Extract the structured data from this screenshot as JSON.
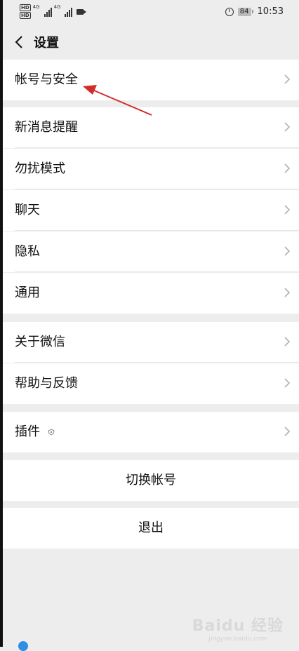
{
  "status_bar": {
    "hd_badges": [
      "HD",
      "HD"
    ],
    "signal_labels": [
      "4G",
      "4G"
    ],
    "battery_level": "84",
    "time": "10:53"
  },
  "header": {
    "title": "设置"
  },
  "groups": [
    {
      "items": [
        {
          "label": "帐号与安全"
        }
      ]
    },
    {
      "items": [
        {
          "label": "新消息提醒"
        },
        {
          "label": "勿扰模式"
        },
        {
          "label": "聊天"
        },
        {
          "label": "隐私"
        },
        {
          "label": "通用"
        }
      ]
    },
    {
      "items": [
        {
          "label": "关于微信"
        },
        {
          "label": "帮助与反馈"
        }
      ]
    },
    {
      "items": [
        {
          "label": "插件"
        }
      ]
    }
  ],
  "actions": {
    "switch_account": "切换帐号",
    "logout": "退出"
  },
  "watermark": {
    "brand": "Baidu 经验",
    "url": "jingyan.baidu.com"
  },
  "annotation_color": "#d42a2a"
}
